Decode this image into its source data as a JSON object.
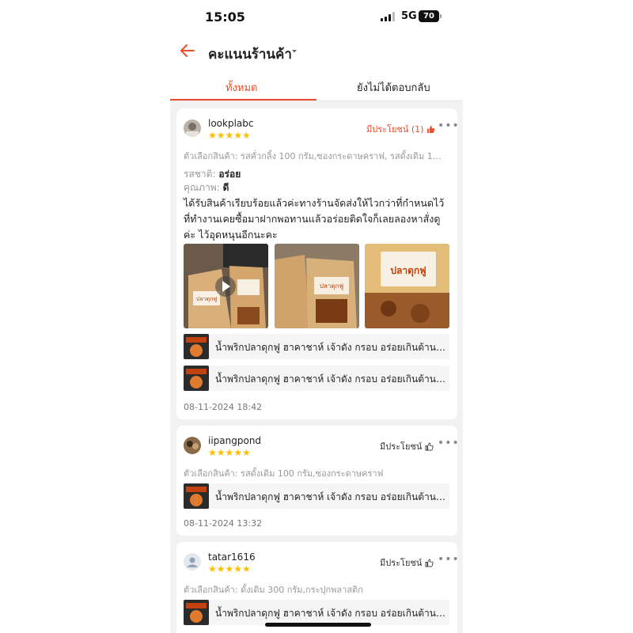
{
  "status_bar": {
    "time": "15:05",
    "network": "5G",
    "battery": "70"
  },
  "header": {
    "title": "คะแนนร้านค้า"
  },
  "tabs": [
    {
      "label": "ทั้งหมด",
      "active": true
    },
    {
      "label": "ยังไม่ได้ตอบกลับ",
      "active": false
    }
  ],
  "reviews": [
    {
      "username": "lookplabc",
      "stars": "★★★★★",
      "rating": 5,
      "helpful_label": "มีประโยชน์ (1)",
      "variant": "ตัวเลือกสินค้า: รสคั่วกลิ้ง 100 กรัม,ซองกระดาษคราฟ, รสดั้งเดิม 100 กรัม,ซ...",
      "taste_label": "รสชาติ:",
      "taste_value": "อร่อย",
      "quality_label": "คุณภาพ:",
      "quality_value": "ดี",
      "text": "ได้รับสินค้าเรียบร้อยแล้วค่ะทางร้านจัดส่งให้ไวกว่าที่กำหนดไว้ที่ทำงานเคยซื้อมาฝากพอทานแล้วอร่อยติดใจก็เลยลองหาสั่งดูค่ะ ไว้อุดหนุนอีกนะคะ",
      "photo_labels": [
        "ปลาดุกฟู",
        "ปลาดุกฟู",
        "ปลาดุกฟู"
      ],
      "products": [
        "น้ำพริกปลาดุกฟู ฮาคาชาห์ เจ้าดัง กรอบ อร่อยเกินต้าน รี...",
        "น้ำพริกปลาดุกฟู ฮาคาชาห์ เจ้าดัง กรอบ อร่อยเกินต้าน รี..."
      ],
      "date": "08-11-2024 18:42"
    },
    {
      "username": "iipangpond",
      "stars": "★★★★★",
      "rating": 5,
      "helpful_label": "มีประโยชน์",
      "variant": "ตัวเลือกสินค้า: รสดั้งเดิม 100 กรัม,ซองกระดาษคราฟ",
      "products": [
        "น้ำพริกปลาดุกฟู ฮาคาชาห์ เจ้าดัง กรอบ อร่อยเกินต้าน รี..."
      ],
      "date": "08-11-2024 13:32"
    },
    {
      "username": "tatar1616",
      "stars": "★★★★★",
      "rating": 5,
      "helpful_label": "มีประโยชน์",
      "variant": "ตัวเลือกสินค้า: ดั้งเดิม 300 กรัม,กระปุกพลาสติก",
      "products": [
        "น้ำพริกปลาดุกฟู ฮาคาชาห์ เจ้าดัง กรอบ อร่อยเกินต้าน รี..."
      ]
    }
  ],
  "colors": {
    "accent": "#ee4d2d",
    "star": "#ffbf00",
    "background": "#f2f2f2"
  }
}
